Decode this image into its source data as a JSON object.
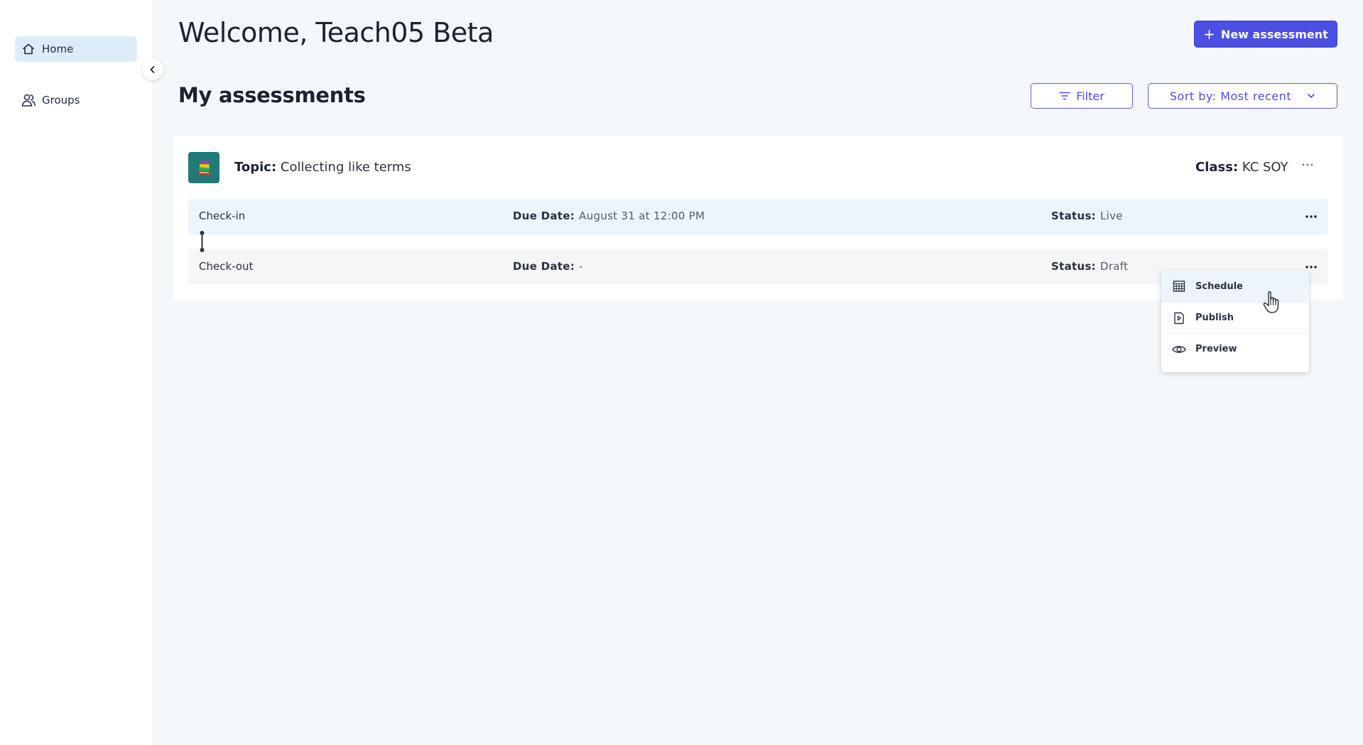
{
  "sidebar": {
    "items": [
      {
        "label": "Home",
        "icon": "home-icon",
        "active": true
      },
      {
        "label": "Groups",
        "icon": "groups-icon",
        "active": false
      }
    ]
  },
  "header": {
    "welcome": "Welcome, Teach05 Beta",
    "new_button": "New assessment"
  },
  "assessments": {
    "title": "My assessments",
    "filter_label": "Filter",
    "sort_label": "Sort by: Most recent",
    "card": {
      "topic_key": "Topic:",
      "topic_value": "Collecting like terms",
      "class_key": "Class:",
      "class_value": "KC SOY",
      "rows": [
        {
          "name": "Check-in",
          "due_key": "Due Date:",
          "due_value": "August 31 at 12:00 PM",
          "status_key": "Status:",
          "status_value": "Live"
        },
        {
          "name": "Check-out",
          "due_key": "Due Date:",
          "due_value": "-",
          "status_key": "Status:",
          "status_value": "Draft"
        }
      ]
    }
  },
  "menu": {
    "items": [
      {
        "label": "Schedule",
        "icon": "calendar-icon"
      },
      {
        "label": "Publish",
        "icon": "publish-icon"
      },
      {
        "label": "Preview",
        "icon": "eye-icon"
      }
    ]
  },
  "colors": {
    "accent": "#4a50e2",
    "active_nav": "#dcecf8",
    "row_highlight": "#ecf5fc",
    "topic_icon_bg": "#1f7a78"
  }
}
